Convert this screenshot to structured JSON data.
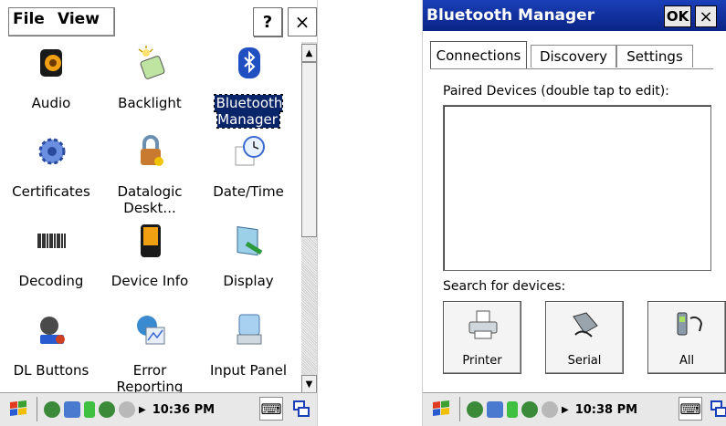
{
  "left_window": {
    "menu": {
      "file": "File",
      "view": "View"
    },
    "help_label": "?",
    "close_label": "×",
    "items": [
      {
        "label": "Audio",
        "icon": "speaker-icon"
      },
      {
        "label": "Backlight",
        "icon": "backlight-icon"
      },
      {
        "label": "Bluetooth Manager",
        "icon": "bluetooth-icon",
        "selected": true
      },
      {
        "label": "Certificates",
        "icon": "certificate-icon"
      },
      {
        "label": "Datalogic Deskt...",
        "icon": "lock-icon"
      },
      {
        "label": "Date/Time",
        "icon": "clock-icon"
      },
      {
        "label": "Decoding",
        "icon": "barcode-icon"
      },
      {
        "label": "Device Info",
        "icon": "device-icon"
      },
      {
        "label": "Display",
        "icon": "display-icon"
      },
      {
        "label": "DL Buttons",
        "icon": "buttons-icon"
      },
      {
        "label": "Error Reporting",
        "icon": "error-report-icon"
      },
      {
        "label": "Input Panel",
        "icon": "keyboard-icon"
      }
    ],
    "taskbar": {
      "time": "10:36 PM"
    }
  },
  "right_window": {
    "title": "Bluetooth Manager",
    "ok_label": "OK",
    "close_label": "×",
    "tabs": [
      "Connections",
      "Discovery",
      "Settings"
    ],
    "active_tab": "Connections",
    "paired_label": "Paired Devices (double tap to edit):",
    "search_label": "Search for devices:",
    "device_buttons": [
      {
        "label": "Printer",
        "icon": "printer-icon"
      },
      {
        "label": "Serial",
        "icon": "serial-icon"
      },
      {
        "label": "All",
        "icon": "all-devices-icon"
      }
    ],
    "taskbar": {
      "time": "10:38 PM"
    }
  },
  "colors": {
    "title_bar": "#0a2486",
    "selection": "#0a246a"
  }
}
